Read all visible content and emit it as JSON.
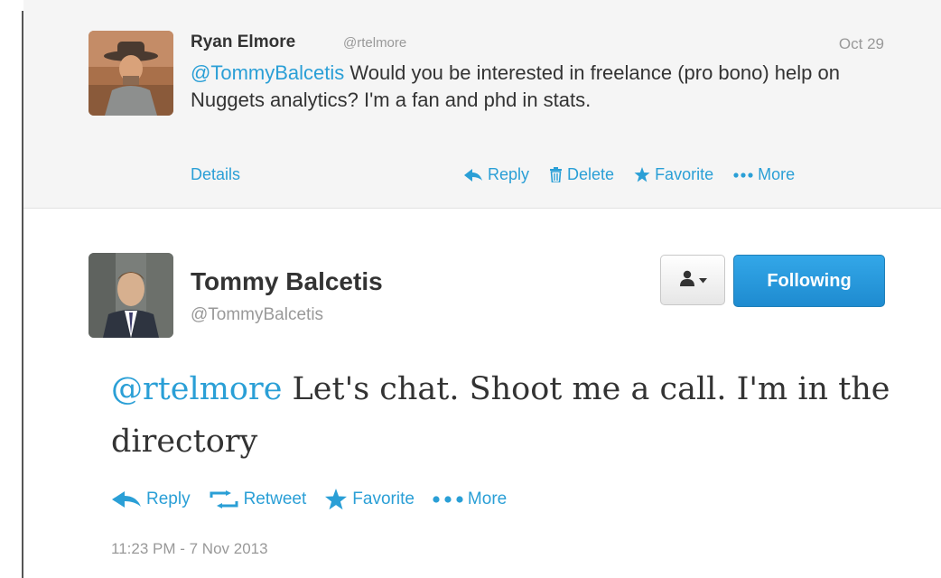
{
  "reply": {
    "author_name": "Ryan Elmore",
    "author_handle": "@rtelmore",
    "date": "Oct 29",
    "mention": "@TommyBalcetis",
    "text": " Would you be interested in freelance (pro bono) help on Nuggets analytics? I'm a fan and phd in stats.",
    "details_label": "Details",
    "actions": {
      "reply": "Reply",
      "delete": "Delete",
      "favorite": "Favorite",
      "more": "More"
    }
  },
  "tweet": {
    "author_name": "Tommy Balcetis",
    "author_handle": "@TommyBalcetis",
    "follow_label": "Following",
    "mention": "@rtelmore",
    "text": " Let's chat. Shoot me a call. I'm in the directory",
    "actions": {
      "reply": "Reply",
      "retweet": "Retweet",
      "favorite": "Favorite",
      "more": "More"
    },
    "timestamp": "11:23 PM - 7 Nov 2013"
  },
  "colors": {
    "link": "#2a9fd6",
    "muted": "#999999",
    "text": "#333333",
    "follow_button": "#2a9fd6"
  }
}
